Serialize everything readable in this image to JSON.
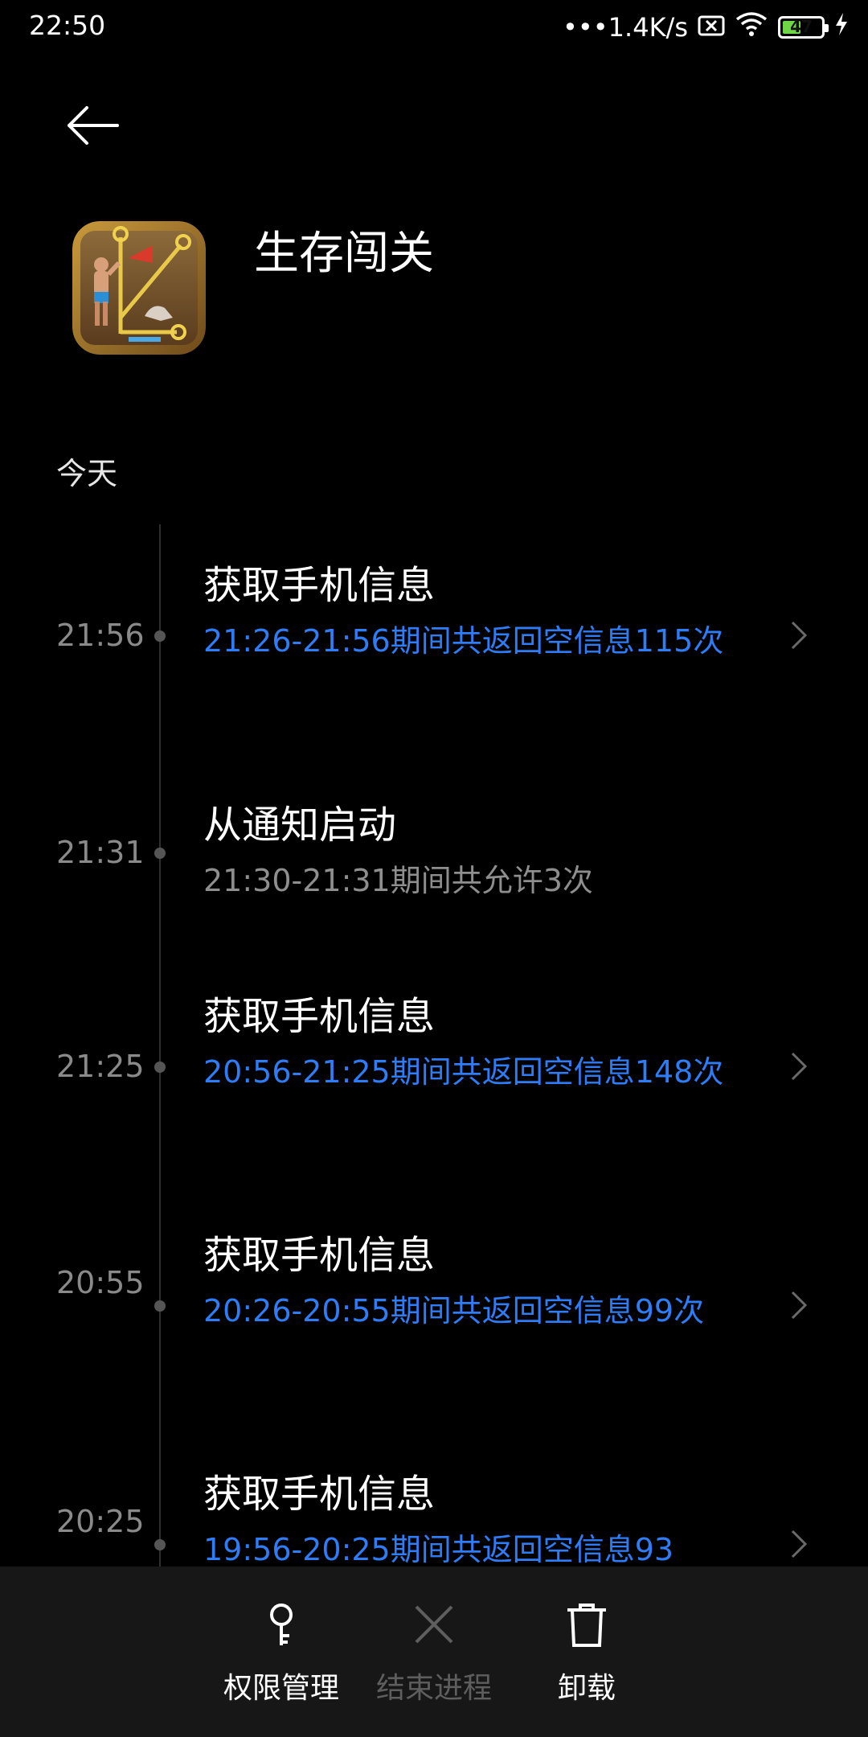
{
  "status_bar": {
    "time": "22:50",
    "network_speed": "•••1.4K/s",
    "battery_level": "47",
    "battery_percent": 47,
    "icons": [
      "sim-off-icon",
      "wifi-icon",
      "battery-icon",
      "charging-icon"
    ]
  },
  "header": {
    "back_icon": "back-arrow-icon",
    "app_name": "生存闯关"
  },
  "section": {
    "label": "今天"
  },
  "entries": [
    {
      "time": "21:56",
      "title": "获取手机信息",
      "detail": "21:26-21:56期间共返回空信息115次",
      "detail_color": "#2e7cf6",
      "has_chevron": true
    },
    {
      "time": "21:31",
      "title": "从通知启动",
      "detail": "21:30-21:31期间共允许3次",
      "detail_color": "#8e8e8e",
      "has_chevron": false
    },
    {
      "time": "21:25",
      "title": "获取手机信息",
      "detail": "20:56-21:25期间共返回空信息148次",
      "detail_color": "#2e7cf6",
      "has_chevron": true
    },
    {
      "time": "20:55",
      "title": "获取手机信息",
      "detail": "20:26-20:55期间共返回空信息99次",
      "detail_color": "#2e7cf6",
      "has_chevron": true
    },
    {
      "time": "20:25",
      "title": "获取手机信息",
      "detail": "19:56-20:25期间共返回空信息93",
      "detail_color": "#2e7cf6",
      "has_chevron": true
    }
  ],
  "bottom_actions": [
    {
      "label": "权限管理",
      "icon": "key-icon",
      "enabled": true
    },
    {
      "label": "结束进程",
      "icon": "close-icon",
      "enabled": false
    },
    {
      "label": "卸载",
      "icon": "trash-icon",
      "enabled": true
    }
  ],
  "colors": {
    "background": "#000000",
    "accent_blue": "#2e7cf6",
    "bottom_bar": "#171717",
    "battery_green": "#6fd646"
  }
}
